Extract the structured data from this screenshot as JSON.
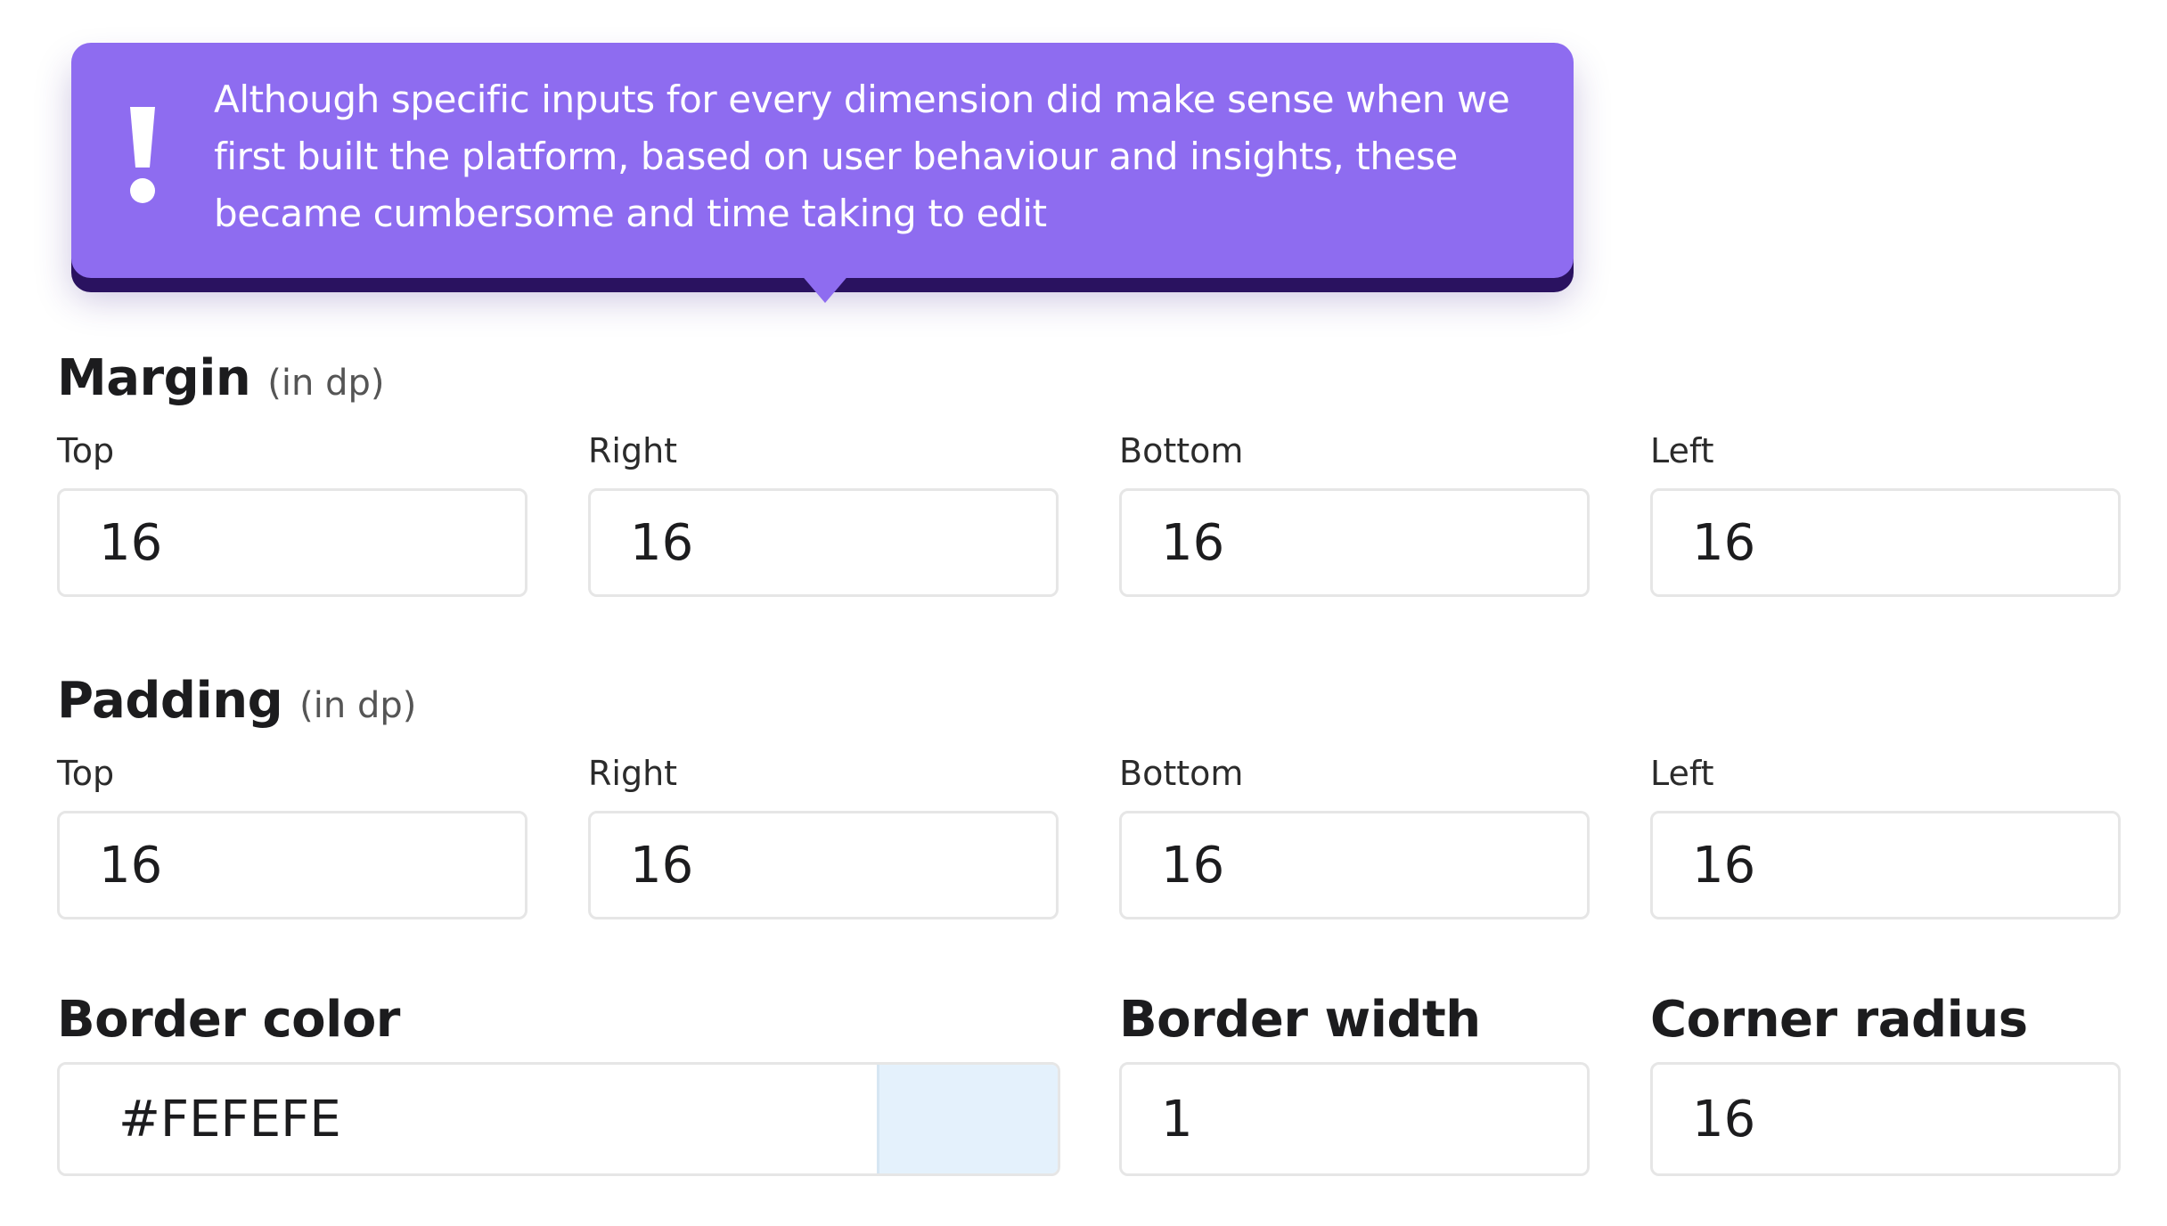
{
  "callout": {
    "icon": "exclamation-icon",
    "color": "#8e6cf0",
    "text": "Although specific inputs for every dimension did make sense when we first built the platform, based on user behaviour and insights, these became cumbersome and time taking to edit"
  },
  "margin": {
    "title": "Margin",
    "unit": "(in dp)",
    "fields": [
      {
        "label": "Top",
        "value": "16"
      },
      {
        "label": "Right",
        "value": "16"
      },
      {
        "label": "Bottom",
        "value": "16"
      },
      {
        "label": "Left",
        "value": "16"
      }
    ]
  },
  "padding": {
    "title": "Padding",
    "unit": "(in dp)",
    "fields": [
      {
        "label": "Top",
        "value": "16"
      },
      {
        "label": "Right",
        "value": "16"
      },
      {
        "label": "Bottom",
        "value": "16"
      },
      {
        "label": "Left",
        "value": "16"
      }
    ]
  },
  "border_color": {
    "title": "Border color",
    "value": "#FEFEFE",
    "swatch_color": "#e4f1fc"
  },
  "border_width": {
    "title": "Border width",
    "value": "1"
  },
  "corner_radius": {
    "title": "Corner radius",
    "value": "16"
  }
}
